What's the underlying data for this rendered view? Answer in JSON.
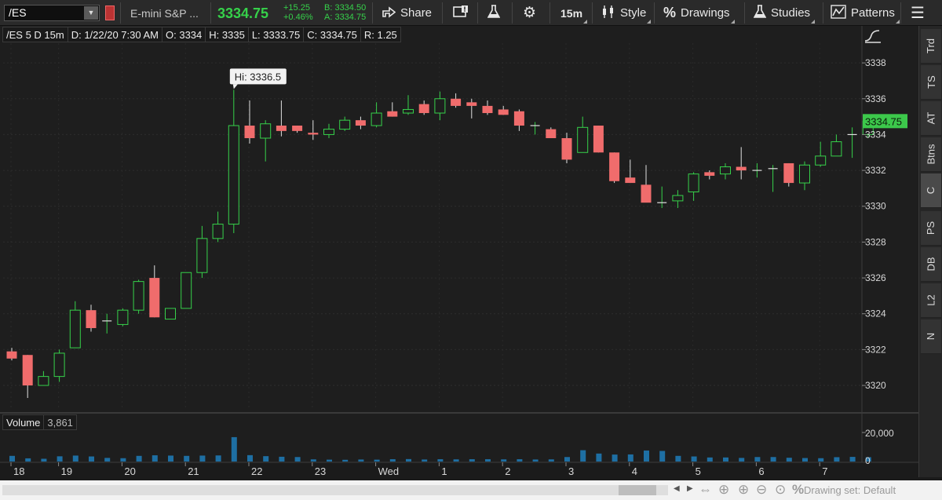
{
  "toolbar": {
    "symbol": "/ES",
    "description": "E-mini S&P ...",
    "last": "3334.75",
    "change": "+15.25",
    "change_pct": "+0.46%",
    "bid": "B: 3334.50",
    "ask": "A: 3334.75",
    "share": "Share",
    "timeframe": "15m",
    "style": "Style",
    "drawings": "Drawings",
    "studies": "Studies",
    "patterns": "Patterns",
    "colors": {
      "up": "#36d14a",
      "down": "#f06c6c",
      "volume": "#1e6fa3"
    }
  },
  "info_bar": {
    "symbol": "/ES 5 D 15m",
    "date": "D: 1/22/20 7:30 AM",
    "open": "O: 3334",
    "high": "H: 3335",
    "low": "L: 3333.75",
    "close": "C: 3334.75",
    "range": "R: 1.25"
  },
  "chart": {
    "high_label": "Hi: 3336.5",
    "last_price_label": "3334.75",
    "volume_label": "Volume",
    "volume_value": "3,861",
    "volume_axis_label": "20,000",
    "volume_axis_zero": "0"
  },
  "chart_data": {
    "type": "candlestick",
    "y_ticks": [
      "3338",
      "3336",
      "3334",
      "3332",
      "3330",
      "3328",
      "3326",
      "3324",
      "3322",
      "3320"
    ],
    "ylim": [
      3318.6,
      3339.1
    ],
    "x_ticks": [
      "18",
      "19",
      "20",
      "21",
      "22",
      "23",
      "Wed",
      "1",
      "2",
      "3",
      "4",
      "5",
      "6",
      "7"
    ],
    "candles": [
      [
        3321.9,
        3322.1,
        3321.4,
        3321.5
      ],
      [
        3321.7,
        3321.7,
        3319.3,
        3320.0
      ],
      [
        3320.0,
        3320.8,
        3320.0,
        3320.5
      ],
      [
        3320.5,
        3322.0,
        3320.2,
        3321.8
      ],
      [
        3322.1,
        3324.7,
        3322.1,
        3324.2
      ],
      [
        3324.2,
        3324.5,
        3323.0,
        3323.2
      ],
      [
        3323.6,
        3324.0,
        3322.9,
        3323.6
      ],
      [
        3323.4,
        3324.3,
        3323.3,
        3324.2
      ],
      [
        3324.2,
        3325.9,
        3324.0,
        3325.8
      ],
      [
        3326.0,
        3326.7,
        3323.8,
        3323.8
      ],
      [
        3323.7,
        3324.3,
        3323.7,
        3324.3
      ],
      [
        3324.3,
        3326.3,
        3324.3,
        3326.3
      ],
      [
        3326.3,
        3328.9,
        3326.0,
        3328.2
      ],
      [
        3328.2,
        3329.7,
        3328.0,
        3329.0
      ],
      [
        3329.0,
        3336.5,
        3328.5,
        3334.5
      ],
      [
        3334.5,
        3335.9,
        3333.5,
        3333.8
      ],
      [
        3333.8,
        3334.8,
        3332.5,
        3334.6
      ],
      [
        3334.5,
        3335.9,
        3333.9,
        3334.2
      ],
      [
        3334.5,
        3334.5,
        3334.1,
        3334.2
      ],
      [
        3334.1,
        3334.8,
        3333.7,
        3334.0
      ],
      [
        3334.0,
        3334.6,
        3333.8,
        3334.3
      ],
      [
        3334.3,
        3335.0,
        3334.2,
        3334.8
      ],
      [
        3334.8,
        3335.0,
        3334.3,
        3334.5
      ],
      [
        3334.5,
        3335.8,
        3334.4,
        3335.2
      ],
      [
        3335.3,
        3335.8,
        3335.0,
        3335.0
      ],
      [
        3335.2,
        3336.2,
        3335.1,
        3335.4
      ],
      [
        3335.7,
        3335.9,
        3335.1,
        3335.2
      ],
      [
        3335.2,
        3336.4,
        3334.8,
        3336.0
      ],
      [
        3336.0,
        3336.3,
        3335.5,
        3335.6
      ],
      [
        3335.8,
        3336.0,
        3334.9,
        3335.6
      ],
      [
        3335.6,
        3335.9,
        3335.1,
        3335.2
      ],
      [
        3335.4,
        3335.6,
        3335.1,
        3335.1
      ],
      [
        3335.3,
        3335.4,
        3334.2,
        3334.5
      ],
      [
        3334.5,
        3334.7,
        3334.0,
        3334.5
      ],
      [
        3334.3,
        3334.4,
        3333.8,
        3333.8
      ],
      [
        3333.8,
        3334.1,
        3332.4,
        3332.6
      ],
      [
        3333.0,
        3335.0,
        3333.0,
        3334.4
      ],
      [
        3334.5,
        3334.5,
        3333.0,
        3333.0
      ],
      [
        3333.0,
        3333.0,
        3331.3,
        3331.4
      ],
      [
        3331.6,
        3332.6,
        3331.3,
        3331.3
      ],
      [
        3331.2,
        3332.3,
        3330.8,
        3330.2
      ],
      [
        3330.2,
        3331.1,
        3329.9,
        3330.2
      ],
      [
        3330.3,
        3330.9,
        3329.9,
        3330.6
      ],
      [
        3330.8,
        3331.9,
        3330.3,
        3331.8
      ],
      [
        3331.9,
        3332.0,
        3331.5,
        3331.7
      ],
      [
        3331.8,
        3332.4,
        3331.5,
        3332.2
      ],
      [
        3332.2,
        3333.3,
        3331.5,
        3332.0
      ],
      [
        3332.0,
        3332.4,
        3331.6,
        3332.0
      ],
      [
        3332.1,
        3332.3,
        3330.8,
        3332.1
      ],
      [
        3332.4,
        3332.4,
        3331.1,
        3331.3
      ],
      [
        3331.3,
        3332.5,
        3330.9,
        3332.3
      ],
      [
        3332.3,
        3333.6,
        3332.2,
        3332.8
      ],
      [
        3332.8,
        3334.0,
        3332.8,
        3333.6
      ],
      [
        3334.0,
        3334.4,
        3332.7,
        3334.0
      ],
      [
        3334.0,
        3335.0,
        3333.8,
        3334.75
      ]
    ],
    "volume_max": 20000,
    "volumes": [
      3900,
      2200,
      1900,
      3600,
      4100,
      3500,
      2500,
      2300,
      3900,
      4300,
      4100,
      3900,
      4100,
      4200,
      16800,
      4400,
      3700,
      3300,
      3100,
      1500,
      1300,
      1200,
      1400,
      1300,
      1600,
      1700,
      1400,
      1600,
      1500,
      1600,
      1600,
      1500,
      1600,
      1400,
      1500,
      3100,
      7800,
      5500,
      4800,
      4900,
      7600,
      7300,
      3900,
      3500,
      2800,
      2800,
      2500,
      3100,
      3100,
      2600,
      2400,
      2300,
      3000,
      3200,
      3000
    ]
  },
  "side_tabs": [
    "Trd",
    "TS",
    "AT",
    "Btns",
    "C",
    "PS",
    "DB",
    "L2",
    "N"
  ],
  "bottom": {
    "drawing_set": "Drawing set: Default"
  }
}
